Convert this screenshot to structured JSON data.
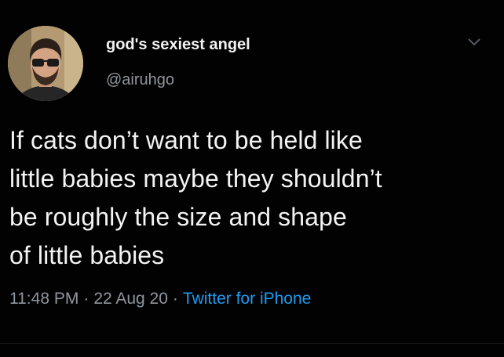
{
  "tweet": {
    "author": {
      "display_name": "god's sexiest angel",
      "handle": "@airuhgo"
    },
    "text_lines": [
      "If cats don’t want to be held like",
      "little babies maybe they shouldn’t",
      "be roughly the size and shape",
      "of little babies"
    ],
    "time": "11:48 PM",
    "date": "22 Aug 20",
    "separator": "·",
    "source": "Twitter for iPhone",
    "menu_icon": "chevron-down-icon"
  },
  "colors": {
    "background": "#020203",
    "text": "#f3f3f3",
    "secondary_text": "#8f969c",
    "link": "#1d9bf0"
  }
}
